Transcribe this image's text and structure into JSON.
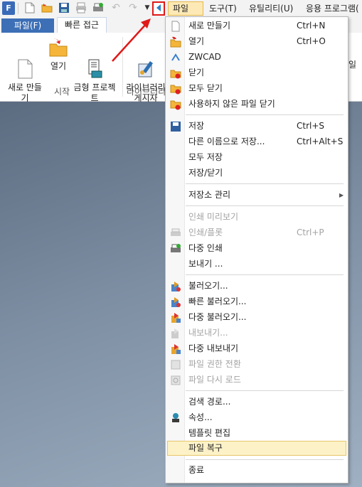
{
  "quick_access": {
    "logo": "F",
    "icons": [
      "new-file-icon",
      "open-folder-icon",
      "save-icon",
      "print-icon",
      "multi-print-icon",
      "undo-icon",
      "redo-icon",
      "customize-dropdown-icon",
      "collapse-menu-icon"
    ]
  },
  "menubar": {
    "items": [
      "파일(F)",
      "도구(T)",
      "유틸리티(U)",
      "응용 프로그램("
    ]
  },
  "ribbon": {
    "tabs": [
      "파일(F)",
      "빠른 접근"
    ],
    "buttons": [
      {
        "label": "새로 만들\n기"
      },
      {
        "label": "열기"
      },
      {
        "label": "금형 프로젝\n트"
      },
      {
        "label": "라이브러리\n게시자"
      }
    ],
    "groups": [
      "시작",
      "라이브러리"
    ],
    "right_fragment": [
      "일",
      ""
    ]
  },
  "file_menu": {
    "items": [
      {
        "label": "새로 만들기",
        "shortcut": "Ctrl+N",
        "icon": "new-file-icon",
        "disabled": false
      },
      {
        "label": "열기",
        "shortcut": "Ctrl+O",
        "icon": "open-folder-icon",
        "disabled": false
      },
      {
        "label": "ZWCAD",
        "shortcut": "",
        "icon": "zwcad-icon",
        "disabled": false
      },
      {
        "label": "닫기",
        "shortcut": "",
        "icon": "close-file-icon",
        "disabled": false
      },
      {
        "label": "모두 닫기",
        "shortcut": "",
        "icon": "close-all-icon",
        "disabled": false
      },
      {
        "label": "사용하지 않은 파일 닫기",
        "shortcut": "",
        "icon": "close-unused-icon",
        "disabled": false
      },
      {
        "label": "저장",
        "shortcut": "Ctrl+S",
        "icon": "save-icon",
        "disabled": false
      },
      {
        "label": "다른 이름으로 저장...",
        "shortcut": "Ctrl+Alt+S",
        "icon": "",
        "disabled": false
      },
      {
        "label": "모두 저장",
        "shortcut": "",
        "icon": "",
        "disabled": false
      },
      {
        "label": "저장/닫기",
        "shortcut": "",
        "icon": "",
        "disabled": false
      },
      {
        "label": "저장소 관리",
        "shortcut": "",
        "icon": "",
        "disabled": false,
        "submenu": true
      },
      {
        "label": "인쇄 미리보기",
        "shortcut": "",
        "icon": "",
        "disabled": true
      },
      {
        "label": "인쇄/플롯",
        "shortcut": "Ctrl+P",
        "icon": "print-icon",
        "disabled": true
      },
      {
        "label": "다중 인쇄",
        "shortcut": "",
        "icon": "multi-print-icon",
        "disabled": false
      },
      {
        "label": "보내기 ...",
        "shortcut": "",
        "icon": "",
        "disabled": false
      },
      {
        "label": "불러오기...",
        "shortcut": "",
        "icon": "import-icon",
        "disabled": false
      },
      {
        "label": "빠른 불러오기...",
        "shortcut": "",
        "icon": "quick-import-icon",
        "disabled": false
      },
      {
        "label": "다중 불러오기...",
        "shortcut": "",
        "icon": "batch-import-icon",
        "disabled": false
      },
      {
        "label": "내보내기...",
        "shortcut": "",
        "icon": "export-icon",
        "disabled": true
      },
      {
        "label": "다중 내보내기",
        "shortcut": "",
        "icon": "batch-export-icon",
        "disabled": false
      },
      {
        "label": "파일 권한 전환",
        "shortcut": "",
        "icon": "file-permission-icon",
        "disabled": true
      },
      {
        "label": "파일 다시 로드",
        "shortcut": "",
        "icon": "reload-file-icon",
        "disabled": true
      },
      {
        "label": "검색 경로...",
        "shortcut": "",
        "icon": "",
        "disabled": false
      },
      {
        "label": "속성...",
        "shortcut": "",
        "icon": "properties-icon",
        "disabled": false
      },
      {
        "label": "템플릿 편집",
        "shortcut": "",
        "icon": "",
        "disabled": false
      },
      {
        "label": "파일 복구",
        "shortcut": "",
        "icon": "",
        "disabled": false,
        "highlighted": true
      },
      {
        "label": "종료",
        "shortcut": "",
        "icon": "",
        "disabled": false
      }
    ]
  },
  "colors": {
    "accent": "#3d6fb6",
    "annotation": "#e01919",
    "highlight": "#fdf2c7"
  }
}
